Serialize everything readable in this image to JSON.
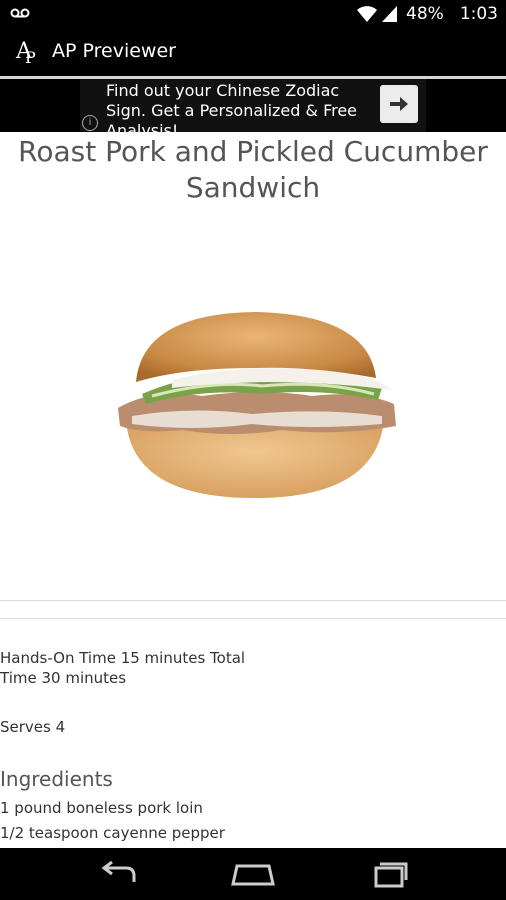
{
  "status_bar": {
    "battery": "48%",
    "time": "1:03",
    "icons": [
      "voicemail-icon",
      "wifi-icon",
      "signal-icon",
      "battery-icon"
    ]
  },
  "app_bar": {
    "logo_letters": "AP",
    "title": "AP Previewer"
  },
  "ad": {
    "text": "Find out your Chinese Zodiac Sign. Get a Personalized & Free Analysis!",
    "info_icon": "info-icon",
    "button_icon": "arrow-right-icon"
  },
  "recipe": {
    "title": "Roast Pork and Pickled Cucumber Sandwich",
    "times": "Hands-On Time  15 minutes  Total Time  30 minutes",
    "serves": "Serves 4",
    "ingredients_heading": "Ingredients",
    "ingredients": [
      "1 pound boneless pork loin",
      "1/2 teaspoon cayenne pepper"
    ]
  },
  "nav_bar": {
    "icons": [
      "back-icon",
      "home-icon",
      "recent-apps-icon"
    ]
  },
  "colors": {
    "bar_background": "#000000",
    "title_text": "#555555",
    "body_text": "#333333"
  }
}
